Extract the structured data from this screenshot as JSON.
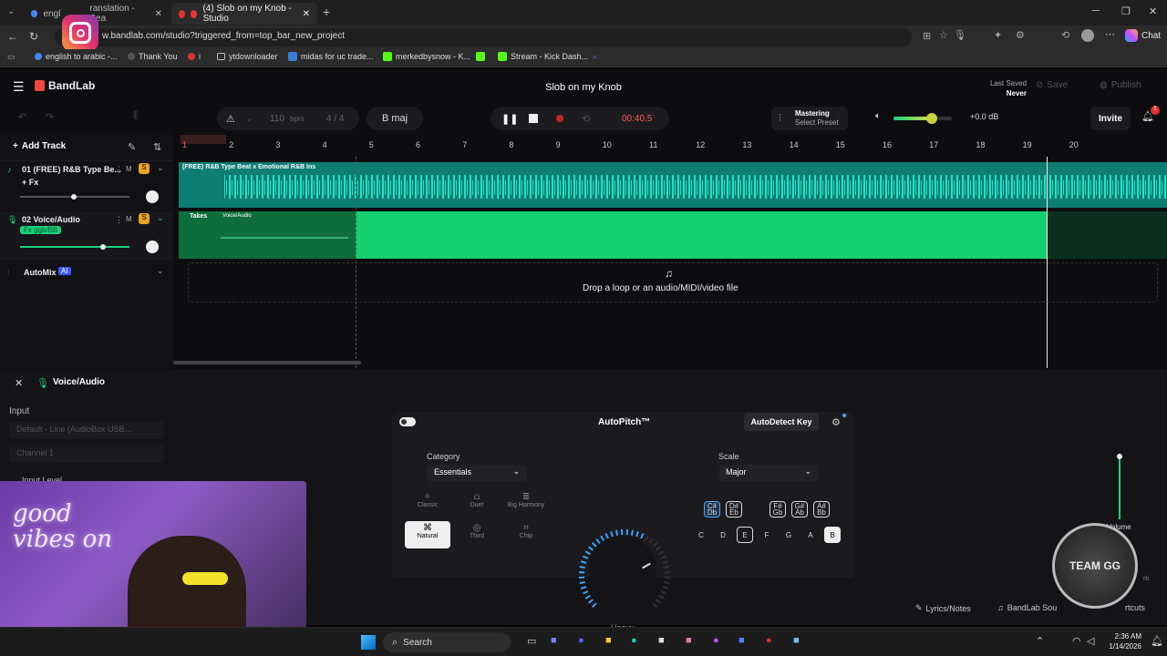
{
  "browser": {
    "tabs": [
      {
        "label": "engl",
        "label2": "ranslation - Sea"
      },
      {
        "label": "(4) Slob on my Knob - Studio"
      }
    ],
    "url": "w.bandlab.com/studio?triggered_from=top_bar_new_project",
    "bookmarks": [
      "english to arabic -...",
      "Thank You",
      "i",
      "ytdownloader",
      "midas for uc trade...",
      "merkedbysnow - K...",
      "Stream - Kick Dash..."
    ],
    "chat_label": "Chat"
  },
  "app": {
    "logo": "BandLab",
    "project_title": "Slob on my Knob",
    "last_saved_label": "Last Saved",
    "last_saved_value": "Never",
    "save_label": "Save",
    "publish_label": "Publish",
    "bpm": "110",
    "bpm_unit": "bpm",
    "time_sig": "4 / 4",
    "key": "B maj",
    "time": "00:40.5",
    "mastering_label": "Mastering",
    "mastering_preset": "Select Preset",
    "master_gain": "+0.0 dB",
    "invite_label": "Invite",
    "notifications": "1",
    "add_track_label": "Add Track",
    "bars": [
      "1",
      "2",
      "3",
      "4",
      "5",
      "6",
      "7",
      "8",
      "9",
      "10",
      "11",
      "12",
      "13",
      "14",
      "15",
      "16",
      "17",
      "18",
      "19",
      "20"
    ],
    "tracks": [
      {
        "name": "01  (FREE) R&B Type Be...",
        "fx": "+ Fx",
        "clip": "(FREE) R&B Type Beat x Emotional R&B Ins"
      },
      {
        "name": "02  Voice/Audio",
        "fx": "Fx ggb/BB",
        "clip": "Voice/Audio",
        "takes": "Takes"
      }
    ],
    "automix_label": "AutoMix",
    "automix_badge": "AI",
    "drop_text": "Drop a loop or an audio/MIDI/video file"
  },
  "panel": {
    "title": "Voice/Audio",
    "input_label": "Input",
    "input_device": "Default - Line (AudioBox USB...",
    "channel": "Channel 1",
    "input_level_label": "Input Level",
    "volume_label": "Volume",
    "reverb_label": "rb",
    "lyrics_label": "Lyrics/Notes",
    "sounds_label": "BandLab Sou",
    "shortcuts_label": "rtcuts",
    "autopitch": {
      "title": "AutoPitch™",
      "autodetect_label": "AutoDetect Key",
      "category_label": "Category",
      "category_value": "Essentials",
      "scale_label": "Scale",
      "scale_value": "Major",
      "knob_label": "Heavy",
      "knob_level": 0.6,
      "effects": [
        "Classic",
        "Duet",
        "Big Harmony",
        "Natural",
        "Third",
        "Chip"
      ],
      "sharps": [
        [
          "C#",
          "Db"
        ],
        [
          "D#",
          "Eb"
        ],
        [
          "F#",
          "Gb"
        ],
        [
          "G#",
          "Ab"
        ],
        [
          "A#",
          "Bb"
        ]
      ],
      "naturals": [
        "C",
        "D",
        "E",
        "F",
        "G",
        "A",
        "B"
      ]
    }
  },
  "taskbar": {
    "search_placeholder": "Search",
    "time": "2:36 AM",
    "date": "1/14/2026"
  },
  "webcam": {
    "overlay_text": "good vibes on",
    "badge_text": "TEAM GG"
  },
  "colors": {
    "accent": "#19d27c",
    "teal": "#18c7b0",
    "record": "#e0312f",
    "time": "#ff5a5a"
  }
}
